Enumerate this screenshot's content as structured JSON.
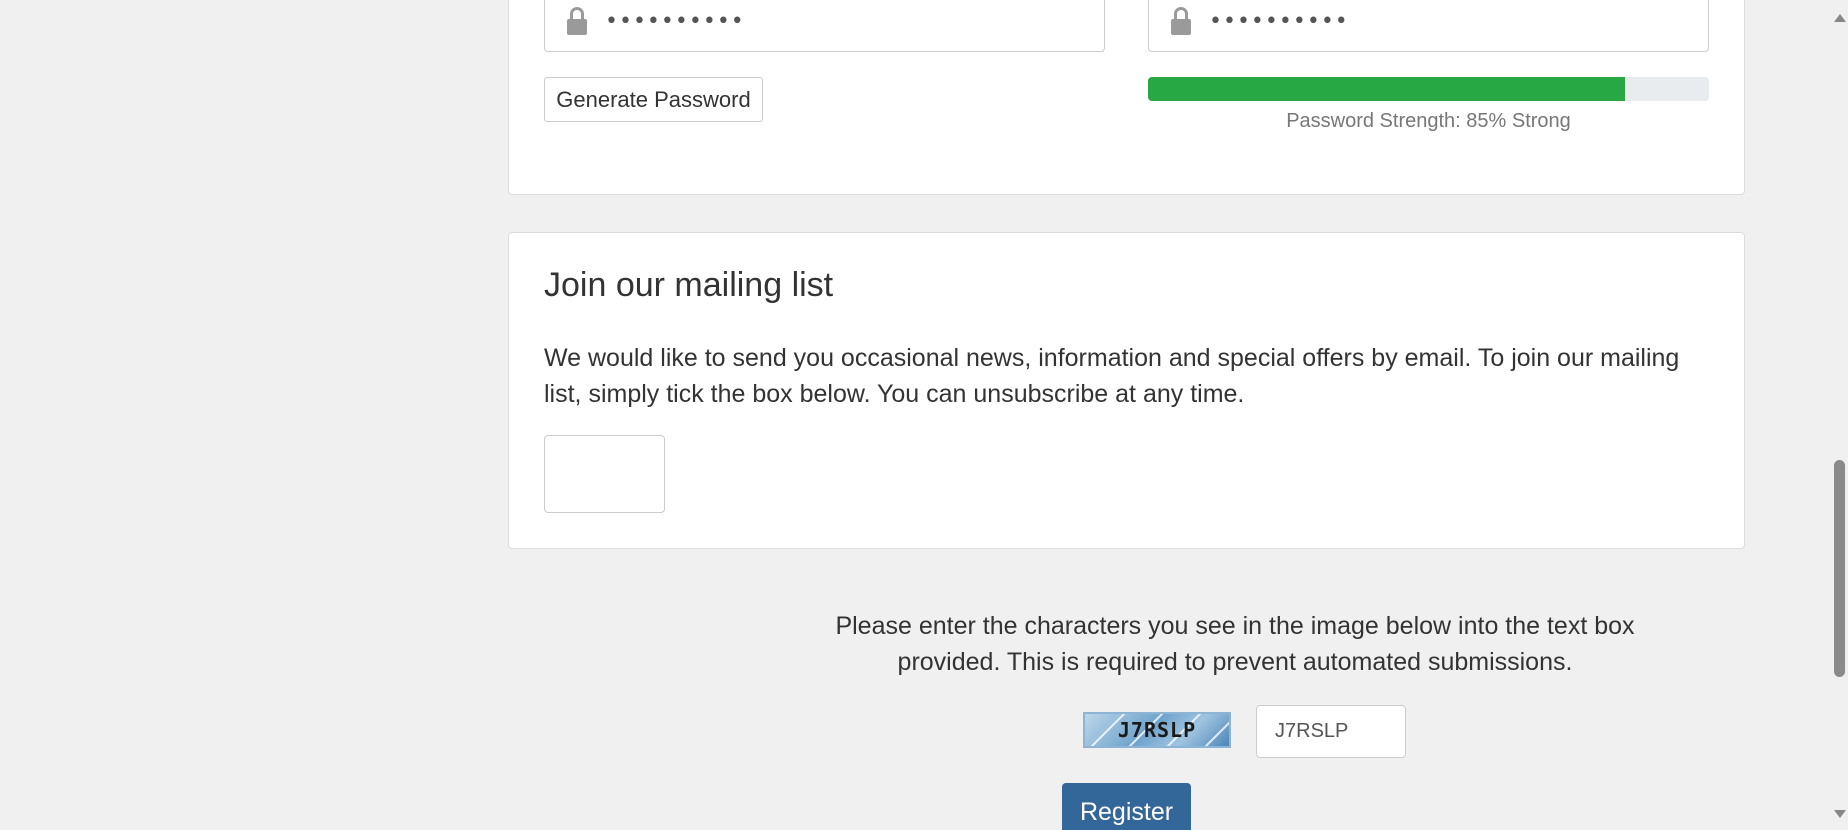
{
  "password_section": {
    "password_value": "••••••••••",
    "confirm_value": "••••••••••",
    "generate_label": "Generate Password",
    "strength_percent": 85,
    "strength_text": "Password Strength: 85% Strong",
    "strength_color": "#28a745"
  },
  "mailing_list": {
    "heading": "Join our mailing list",
    "description": "We would like to send you occasional news, information and special offers by email. To join our mailing list, simply tick the box below. You can unsubscribe at any time."
  },
  "captcha": {
    "instructions": "Please enter the characters you see in the image below into the text box provided. This is required to prevent automated submissions.",
    "image_code": "J7RSLP",
    "input_value": "J7RSLP"
  },
  "register_label": "Register",
  "colors": {
    "accent": "#336699",
    "background": "#f0f0f0"
  }
}
